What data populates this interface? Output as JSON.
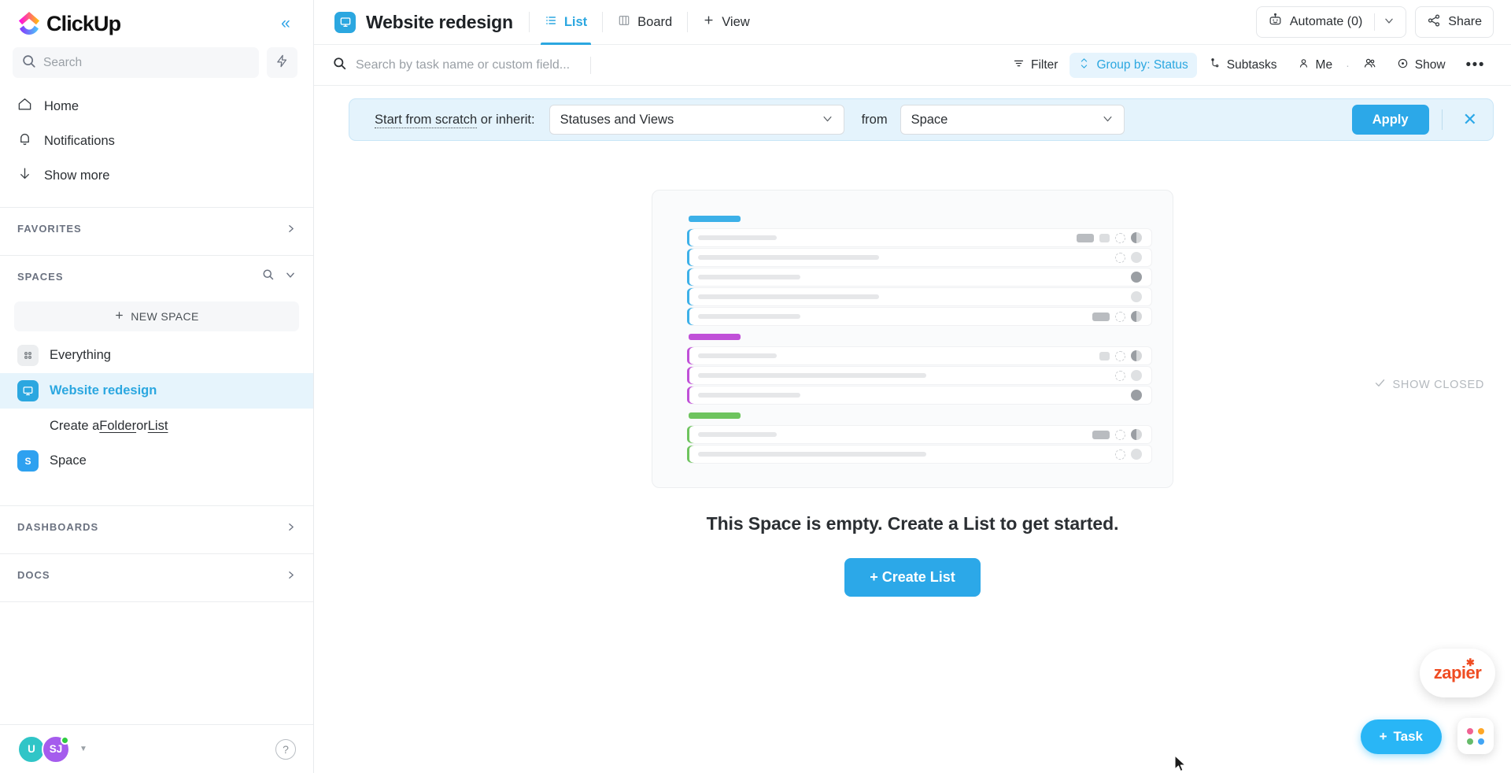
{
  "brand": {
    "name": "ClickUp",
    "accent": "#2ca8e8"
  },
  "sidebar": {
    "search": {
      "placeholder": "Search"
    },
    "nav": [
      {
        "label": "Home",
        "icon": "home-icon"
      },
      {
        "label": "Notifications",
        "icon": "bell-icon"
      },
      {
        "label": "Show more",
        "icon": "arrow-down-icon"
      }
    ],
    "sections": {
      "favorites": "FAVORITES",
      "spaces": "SPACES",
      "dashboards": "DASHBOARDS",
      "docs": "DOCS"
    },
    "new_space_label": "NEW SPACE",
    "spaces": [
      {
        "label": "Everything",
        "badge": "",
        "style": "grey",
        "active": false
      },
      {
        "label": "Website redesign",
        "badge": "",
        "style": "teal",
        "active": true
      },
      {
        "label": "Space",
        "badge": "S",
        "style": "blue",
        "active": false
      }
    ],
    "create_row": {
      "prefix": "Create a ",
      "folder": "Folder",
      "middle": " or ",
      "list": "List"
    },
    "avatars": [
      {
        "initials": "U",
        "color": "#30c5c7"
      },
      {
        "initials": "SJ",
        "color": "#a55ced"
      }
    ],
    "help_label": "?"
  },
  "header": {
    "title": "Website redesign",
    "tabs": [
      {
        "label": "List",
        "icon": "list-icon",
        "active": true
      },
      {
        "label": "Board",
        "icon": "board-icon",
        "active": false
      },
      {
        "label": "View",
        "icon": "plus-icon",
        "active": false
      }
    ],
    "automate": {
      "label": "Automate (0)",
      "icon": "robot-icon"
    },
    "share": {
      "label": "Share",
      "icon": "share-icon"
    }
  },
  "toolbar": {
    "search_placeholder": "Search by task name or custom field...",
    "items": [
      {
        "label": "Filter",
        "icon": "filter-icon",
        "active": false
      },
      {
        "label": "Group by: Status",
        "icon": "group-icon",
        "active": true
      },
      {
        "label": "Subtasks",
        "icon": "subtasks-icon",
        "active": false
      },
      {
        "label": "Me",
        "icon": "person-icon",
        "active": false
      },
      {
        "label": "Show",
        "icon": "eye-icon",
        "active": false
      }
    ],
    "people_icon": "people-icon",
    "more_label": "•••"
  },
  "banner": {
    "start_link": "Start from scratch",
    "or_inherit": " or inherit:",
    "inherit_value": "Statuses and Views",
    "from_label": "from",
    "from_value": "Space",
    "apply_label": "Apply",
    "close_label": "✕"
  },
  "content": {
    "show_closed": "SHOW CLOSED",
    "show_closed_icon": "check-icon",
    "empty_message": "This Space is empty. Create a List to get started.",
    "create_list_label": "+ Create List",
    "illustration": {
      "groups": [
        {
          "color": "#3cb0e8",
          "rows": [
            {
              "line": 100,
              "tags": [
                "dark",
                "light"
              ],
              "dashed": true,
              "avatar": "half"
            },
            {
              "line": 230,
              "tags": [],
              "dashed": true,
              "avatar": "light"
            },
            {
              "line": 130,
              "tags": [],
              "dashed": false,
              "avatar": "dark"
            },
            {
              "line": 230,
              "tags": [],
              "dashed": false,
              "avatar": "light"
            },
            {
              "line": 130,
              "tags": [
                "dark"
              ],
              "dashed": true,
              "avatar": "half"
            }
          ]
        },
        {
          "color": "#c050d8",
          "rows": [
            {
              "line": 100,
              "tags": [
                "light"
              ],
              "dashed": true,
              "avatar": "half"
            },
            {
              "line": 290,
              "tags": [],
              "dashed": true,
              "avatar": "light"
            },
            {
              "line": 130,
              "tags": [],
              "dashed": false,
              "avatar": "dark"
            }
          ]
        },
        {
          "color": "#6ec45e",
          "rows": [
            {
              "line": 100,
              "tags": [
                "dark"
              ],
              "dashed": true,
              "avatar": "half"
            },
            {
              "line": 290,
              "tags": [],
              "dashed": true,
              "avatar": "light"
            }
          ]
        }
      ]
    }
  },
  "floating": {
    "zapier_label": "zapier",
    "task_label": "Task",
    "task_plus": "+",
    "apps_icon": "apps-grid-icon",
    "apps_colors": [
      "#f06292",
      "#ffa726",
      "#66bb6a",
      "#42a5f5"
    ]
  }
}
